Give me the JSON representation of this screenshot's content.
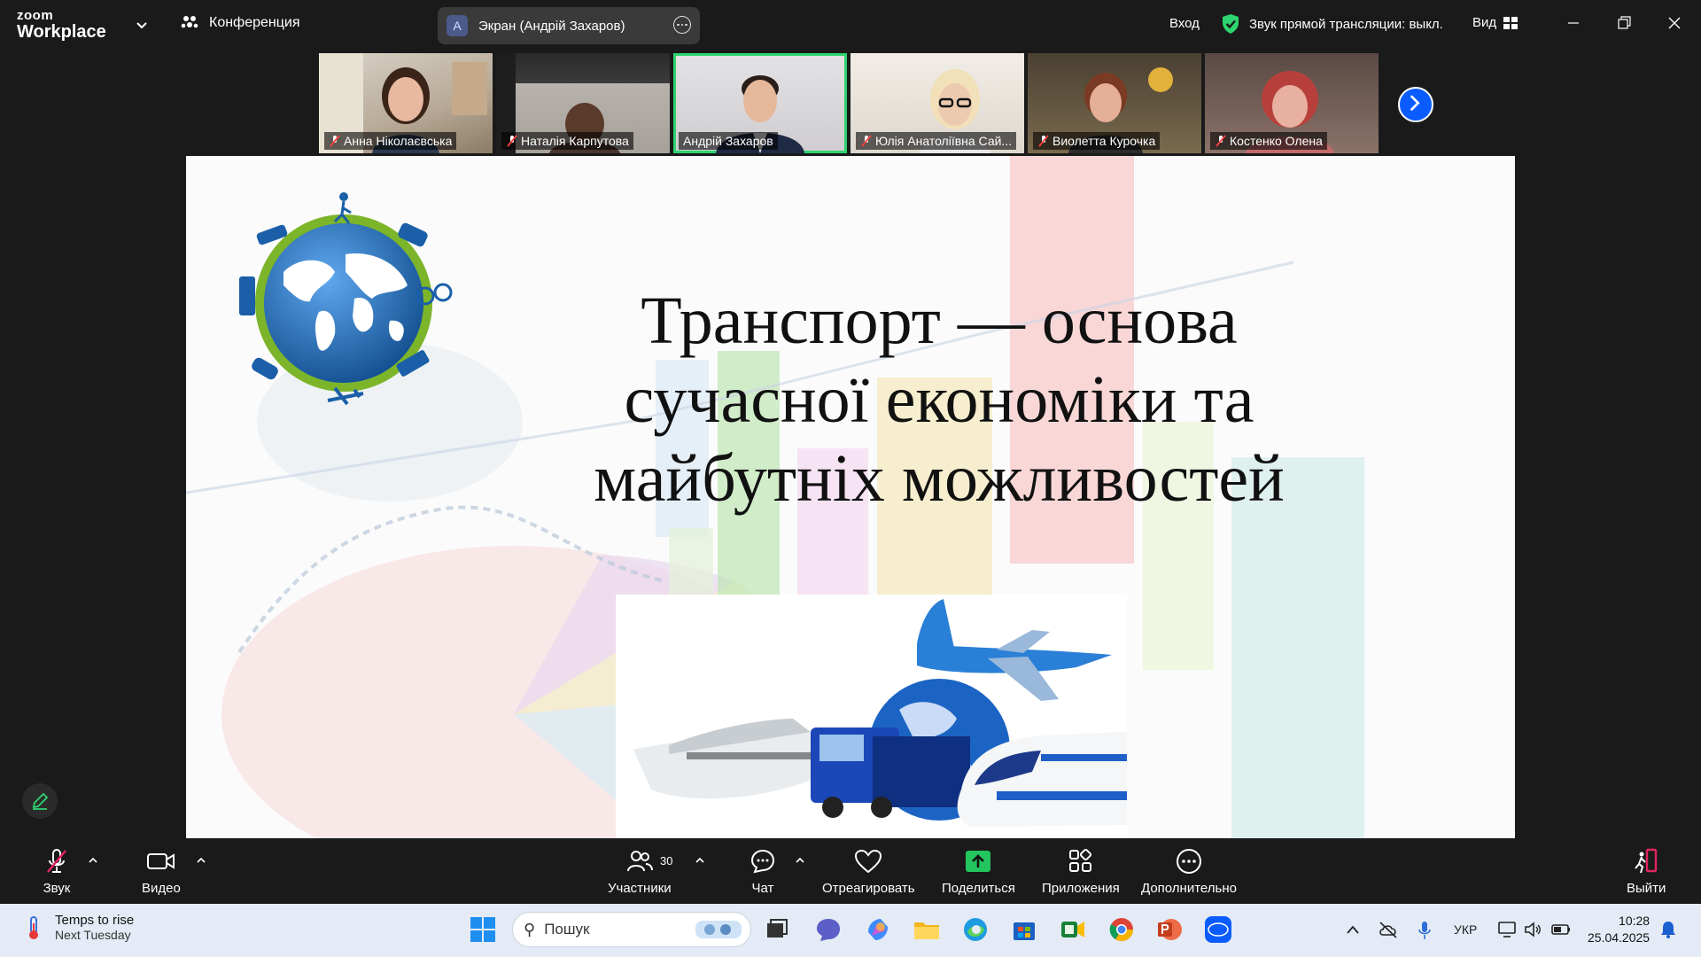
{
  "app": {
    "logo_top": "zoom",
    "logo_bottom": "Workplace"
  },
  "topbar": {
    "meeting_label": "Конференция",
    "share_avatar": "A",
    "share_label": "Экран (Андрій Захаров)",
    "signin": "Вход",
    "live_audio": "Звук прямой трансляции: выкл.",
    "view": "Вид",
    "accent": "#0b5cff",
    "shield_color": "#2dd36f"
  },
  "participants": [
    {
      "name": "Анна Ніколаєвська",
      "muted": true,
      "active": false
    },
    {
      "name": "Наталія Карпутова",
      "muted": true,
      "active": false
    },
    {
      "name": "Андрій Захаров",
      "muted": false,
      "active": true
    },
    {
      "name": "Юлія Анатоліївна Сай...",
      "muted": true,
      "active": false
    },
    {
      "name": "Виолетта Курочка",
      "muted": true,
      "active": false
    },
    {
      "name": "Костенко Олена",
      "muted": true,
      "active": false
    }
  ],
  "slide": {
    "title_line1": "Транспорт — основа",
    "title_line2": "сучасної економіки та",
    "title_line3": "майбутніх можливостей"
  },
  "toolbar": {
    "audio": "Звук",
    "video": "Видео",
    "participants": "Участники",
    "participants_count": "30",
    "chat": "Чат",
    "react": "Отреагировать",
    "share": "Поделиться",
    "apps": "Приложения",
    "more": "Дополнительно",
    "leave": "Выйти",
    "share_color": "#22c55e",
    "leave_color": "#e0245e"
  },
  "taskbar": {
    "weather_title": "Temps to rise",
    "weather_sub": "Next Tuesday",
    "search_placeholder": "Пошук",
    "language": "УКР",
    "time": "10:28",
    "date": "25.04.2025"
  }
}
